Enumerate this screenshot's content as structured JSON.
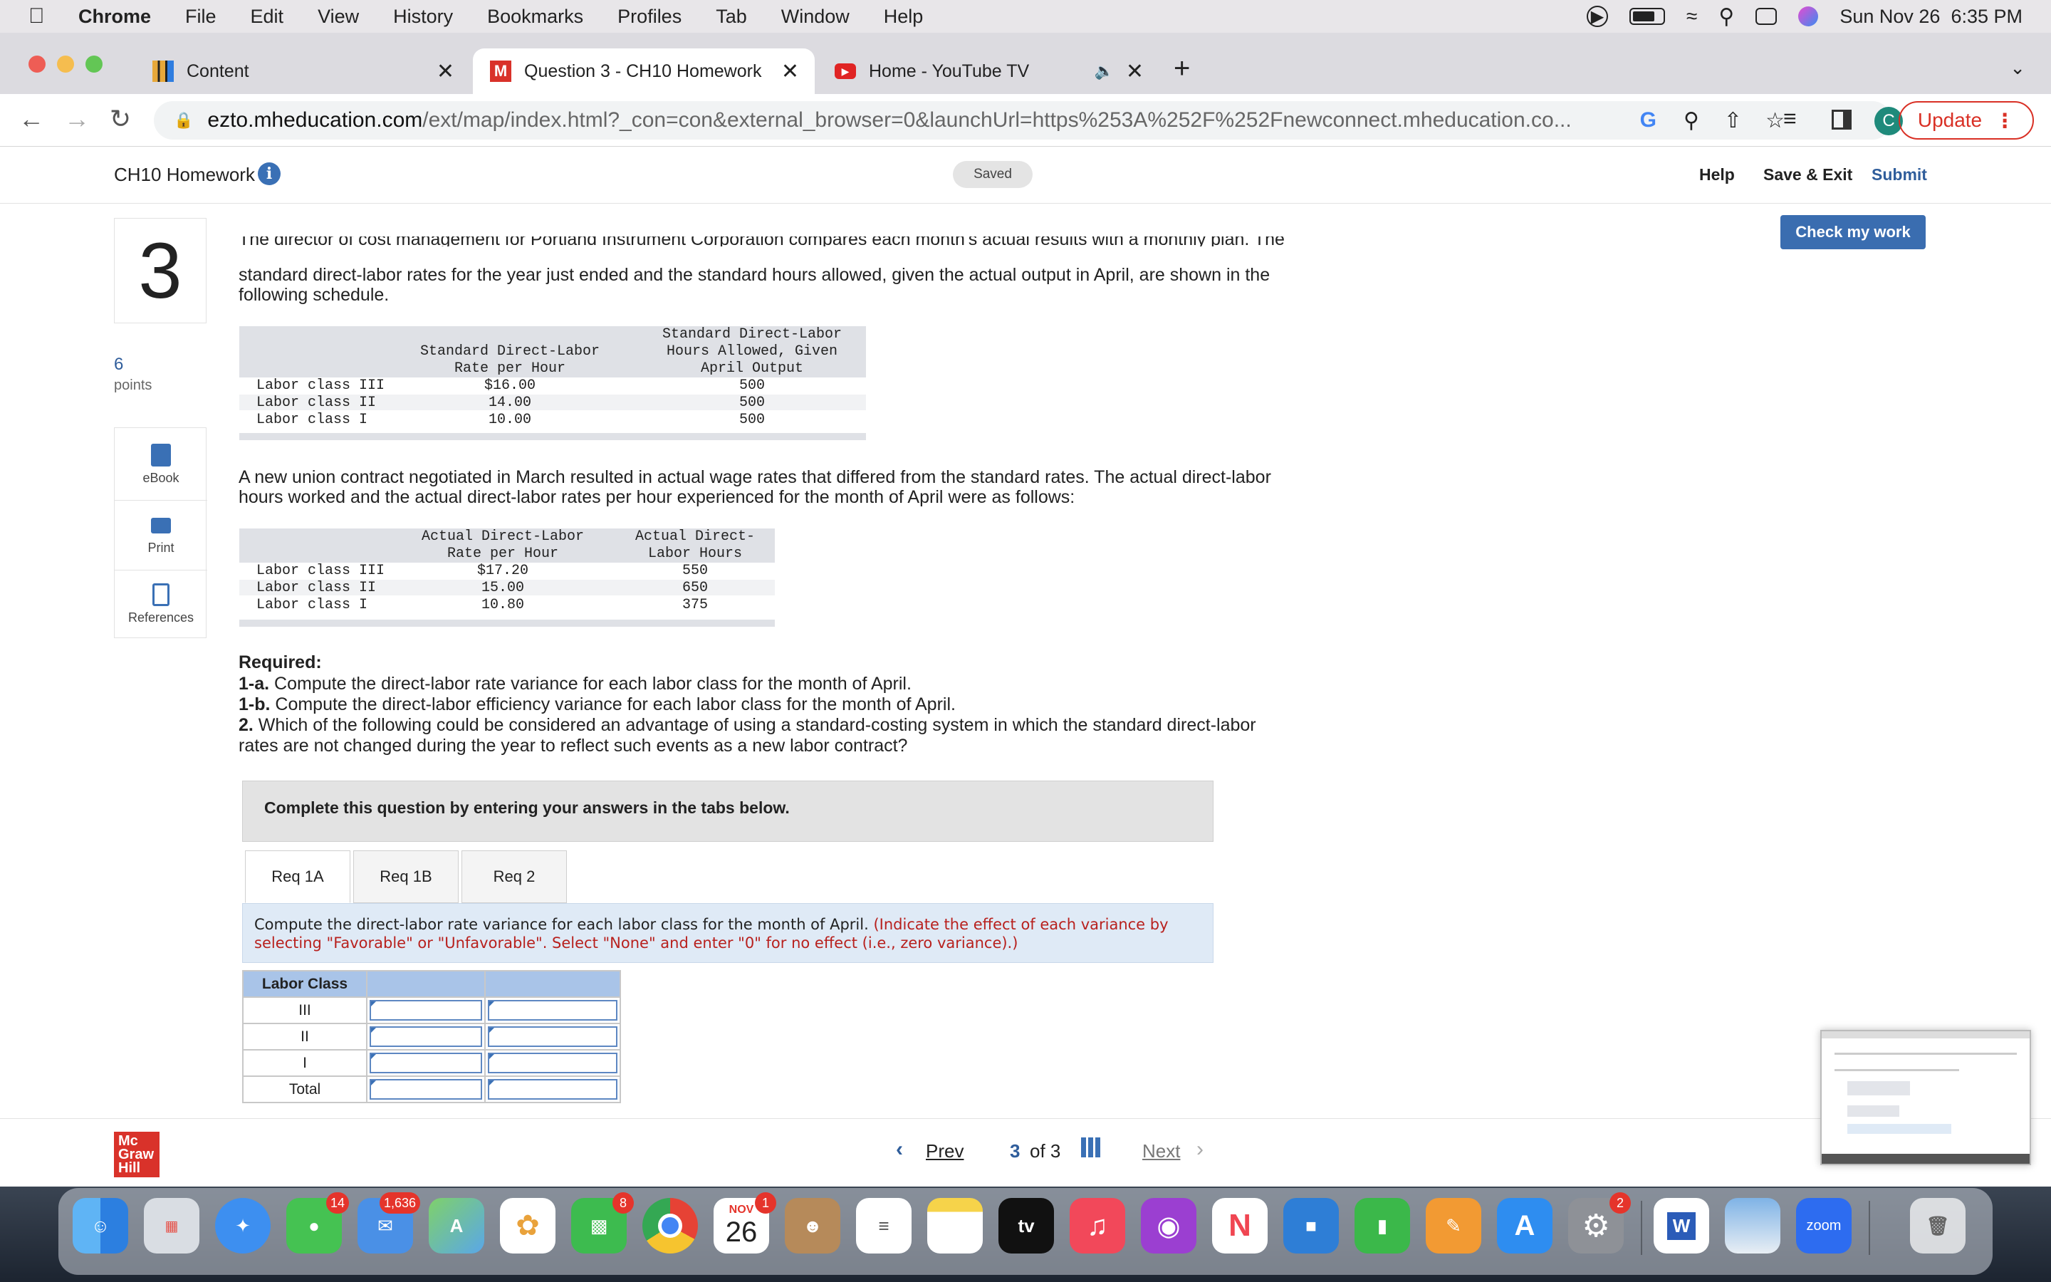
{
  "menubar": {
    "app": "Chrome",
    "items": [
      "File",
      "Edit",
      "View",
      "History",
      "Bookmarks",
      "Profiles",
      "Tab",
      "Window",
      "Help"
    ],
    "clock": "Sun Nov 26  6:35 PM"
  },
  "tabs": [
    {
      "title": "Content"
    },
    {
      "title": "Question 3 - CH10 Homework",
      "favicon": "M"
    },
    {
      "title": "Home - YouTube TV"
    }
  ],
  "address": {
    "host": "ezto.mheducation.com",
    "path": "/ext/map/index.html?_con=con&external_browser=0&launchUrl=https%253A%252F%252Fnewconnect.mheducation.co...",
    "profile_initial": "C",
    "update_label": "Update"
  },
  "header": {
    "title": "CH10 Homework",
    "saved": "Saved",
    "help": "Help",
    "save_exit": "Save & Exit",
    "submit": "Submit"
  },
  "question": {
    "number": "3",
    "points_value": "6",
    "points_label": "points",
    "check_label": "Check my work",
    "intro_cut": "The director of cost management for Portland Instrument Corporation compares each month's actual results with a monthly plan. The",
    "intro_line1": "standard direct-labor rates for the year just ended and the standard hours allowed, given the actual output in April, are shown in the",
    "intro_line2": "following schedule.",
    "para2_line1": "A new union contract negotiated in March resulted in actual wage rates that differed from the standard rates. The actual direct-labor",
    "para2_line2": "hours worked and the actual direct-labor rates per hour experienced for the month of April were as follows:",
    "required_title": "Required:",
    "req1a_key": "1-a.",
    "req1a_text": " Compute the direct-labor rate variance for each labor class for the month of April.",
    "req1b_key": "1-b.",
    "req1b_text": " Compute the direct-labor efficiency variance for each labor class for the month of April.",
    "req2_key": "2.",
    "req2_text_line1": " Which of the following could be considered an advantage of using a standard-costing system in which the standard direct-labor",
    "req2_text_line2": "rates are not changed during the year to reflect such events as a new labor contract?"
  },
  "tools": {
    "ebook": "eBook",
    "print": "Print",
    "references": "References"
  },
  "schedule1": {
    "col1_header": [
      "Standard Direct-Labor",
      "Rate per Hour"
    ],
    "col2_header": [
      "Standard Direct-Labor",
      "Hours Allowed, Given",
      "April Output"
    ],
    "rows": [
      {
        "label": "Labor class III",
        "rate": "$16.00",
        "hours": "500"
      },
      {
        "label": "Labor class II",
        "rate": "14.00",
        "hours": "500"
      },
      {
        "label": "Labor class I",
        "rate": "10.00",
        "hours": "500"
      }
    ]
  },
  "schedule2": {
    "col1_header": [
      "Actual Direct-Labor",
      "Rate per Hour"
    ],
    "col2_header": [
      "Actual Direct-",
      "Labor Hours"
    ],
    "rows": [
      {
        "label": "Labor class III",
        "rate": "$17.20",
        "hours": "550"
      },
      {
        "label": "Labor class II",
        "rate": "15.00",
        "hours": "650"
      },
      {
        "label": "Labor class I",
        "rate": "10.80",
        "hours": "375"
      }
    ]
  },
  "answer": {
    "complete_text": "Complete this question by entering your answers in the tabs below.",
    "tabs": [
      "Req 1A",
      "Req 1B",
      "Req 2"
    ],
    "instruction_main": "Compute the direct-labor rate variance for each labor class for the month of April. ",
    "instruction_red": "(Indicate the effect of each variance by selecting \"Favorable\" or \"Unfavorable\". Select \"None\" and enter \"0\" for no effect (i.e., zero variance).)",
    "table_header": "Labor Class",
    "rows": [
      "III",
      "II",
      "I",
      "Total"
    ]
  },
  "footer": {
    "logo_lines": [
      "Mc",
      "Graw",
      "Hill"
    ],
    "prev": "Prev",
    "current": "3",
    "of_total": "of 3",
    "next": "Next"
  },
  "dock": {
    "messages_badge": "14",
    "mail_badge": "1,636",
    "facetime_badge": "8",
    "calendar_month": "NOV",
    "calendar_day": "26",
    "calendar_badge": "1",
    "settings_badge": "2",
    "zoom_label": "zoom",
    "word_label": "W",
    "tv_label": "tv"
  }
}
